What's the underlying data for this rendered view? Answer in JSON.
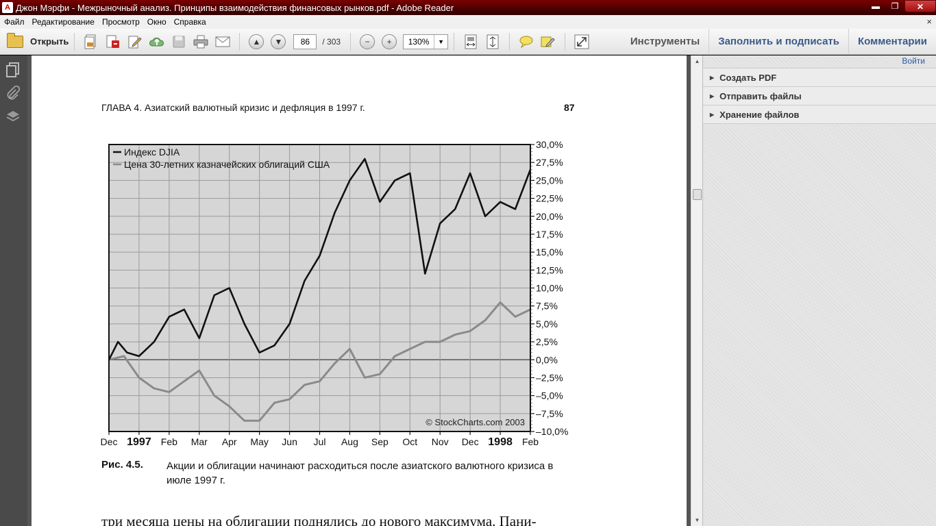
{
  "window": {
    "title": "Джон Мэрфи - Межрыночный анализ. Принципы взаимодействия финансовых рынков.pdf - Adobe Reader",
    "minimize": "▬",
    "restore": "❐",
    "close": "✕"
  },
  "menu": {
    "items": [
      "Файл",
      "Редактирование",
      "Просмотр",
      "Окно",
      "Справка"
    ],
    "close": "×"
  },
  "toolbar": {
    "open_label": "Открыть",
    "page_current": "86",
    "page_total": "/ 303",
    "zoom": "130%",
    "tools_label": "Инструменты",
    "fill_sign_label": "Заполнить и подписать",
    "comments_label": "Комментарии"
  },
  "right_pane": {
    "login": "Войти",
    "sections": [
      "Создать PDF",
      "Отправить файлы",
      "Хранение файлов"
    ]
  },
  "document": {
    "running_head": "ГЛАВА 4. Азиатский валютный кризис и дефляция в 1997 г.",
    "page_number": "87",
    "caption_label": "Рис. 4.5.",
    "caption_text": "Акции и облигации начинают расходиться после азиатского валютного кризиса в июле 1997 г.",
    "body_text": "три месяца цены на облигации поднялись до нового максимума. Пани-"
  },
  "chart_data": {
    "type": "line",
    "x_ticks": [
      "Dec",
      "1997",
      "Feb",
      "Mar",
      "Apr",
      "May",
      "Jun",
      "Jul",
      "Aug",
      "Sep",
      "Oct",
      "Nov",
      "Dec",
      "1998",
      "Feb"
    ],
    "x_ticks_bold": [
      "1997",
      "1998"
    ],
    "y_ticks": [
      "30,0%",
      "27,5%",
      "25,0%",
      "22,5%",
      "20,0%",
      "17,5%",
      "15,0%",
      "12,5%",
      "10,0%",
      "7,5%",
      "5,0%",
      "2,5%",
      "0,0%",
      "–2,5%",
      "–5,0%",
      "–7,5%",
      "–10,0%"
    ],
    "ylim": [
      -10,
      30
    ],
    "grid": true,
    "legend_position": "top-left",
    "credit": "© StockCharts.com 2003",
    "colors": {
      "djia": "#111111",
      "bonds": "#8a8a8a",
      "background": "#d6d6d6"
    },
    "series": [
      {
        "name": "Индекс DJIA",
        "x": [
          0,
          0.3,
          0.6,
          1,
          1.5,
          2,
          2.5,
          3,
          3.5,
          4,
          4.5,
          5,
          5.5,
          6,
          6.5,
          7,
          7.5,
          8,
          8.5,
          9,
          9.5,
          10,
          10.5,
          11,
          11.5,
          12,
          12.5,
          13,
          13.5,
          14
        ],
        "y": [
          0,
          2.5,
          1,
          0.5,
          2.5,
          6,
          7,
          3,
          9,
          10,
          5,
          1,
          2,
          5,
          11,
          14.5,
          20.5,
          25,
          28,
          22,
          25,
          26,
          12,
          19,
          21,
          26,
          20,
          22,
          21,
          26.5
        ]
      },
      {
        "name": "Цена 30-летних казначейских облигаций США",
        "x": [
          0,
          0.5,
          1,
          1.5,
          2,
          2.5,
          3,
          3.5,
          4,
          4.5,
          5,
          5.5,
          6,
          6.5,
          7,
          7.5,
          8,
          8.5,
          9,
          9.5,
          10,
          10.5,
          11,
          11.5,
          12,
          12.5,
          13,
          13.5,
          14
        ],
        "y": [
          0,
          0.5,
          -2.5,
          -4,
          -4.5,
          -3,
          -1.5,
          -5,
          -6.5,
          -8.5,
          -8.5,
          -6,
          -5.5,
          -3.5,
          -3,
          -0.5,
          1.5,
          -2.5,
          -2,
          0.5,
          1.5,
          2.5,
          2.5,
          3.5,
          4,
          5.5,
          8,
          6,
          7
        ]
      }
    ]
  }
}
